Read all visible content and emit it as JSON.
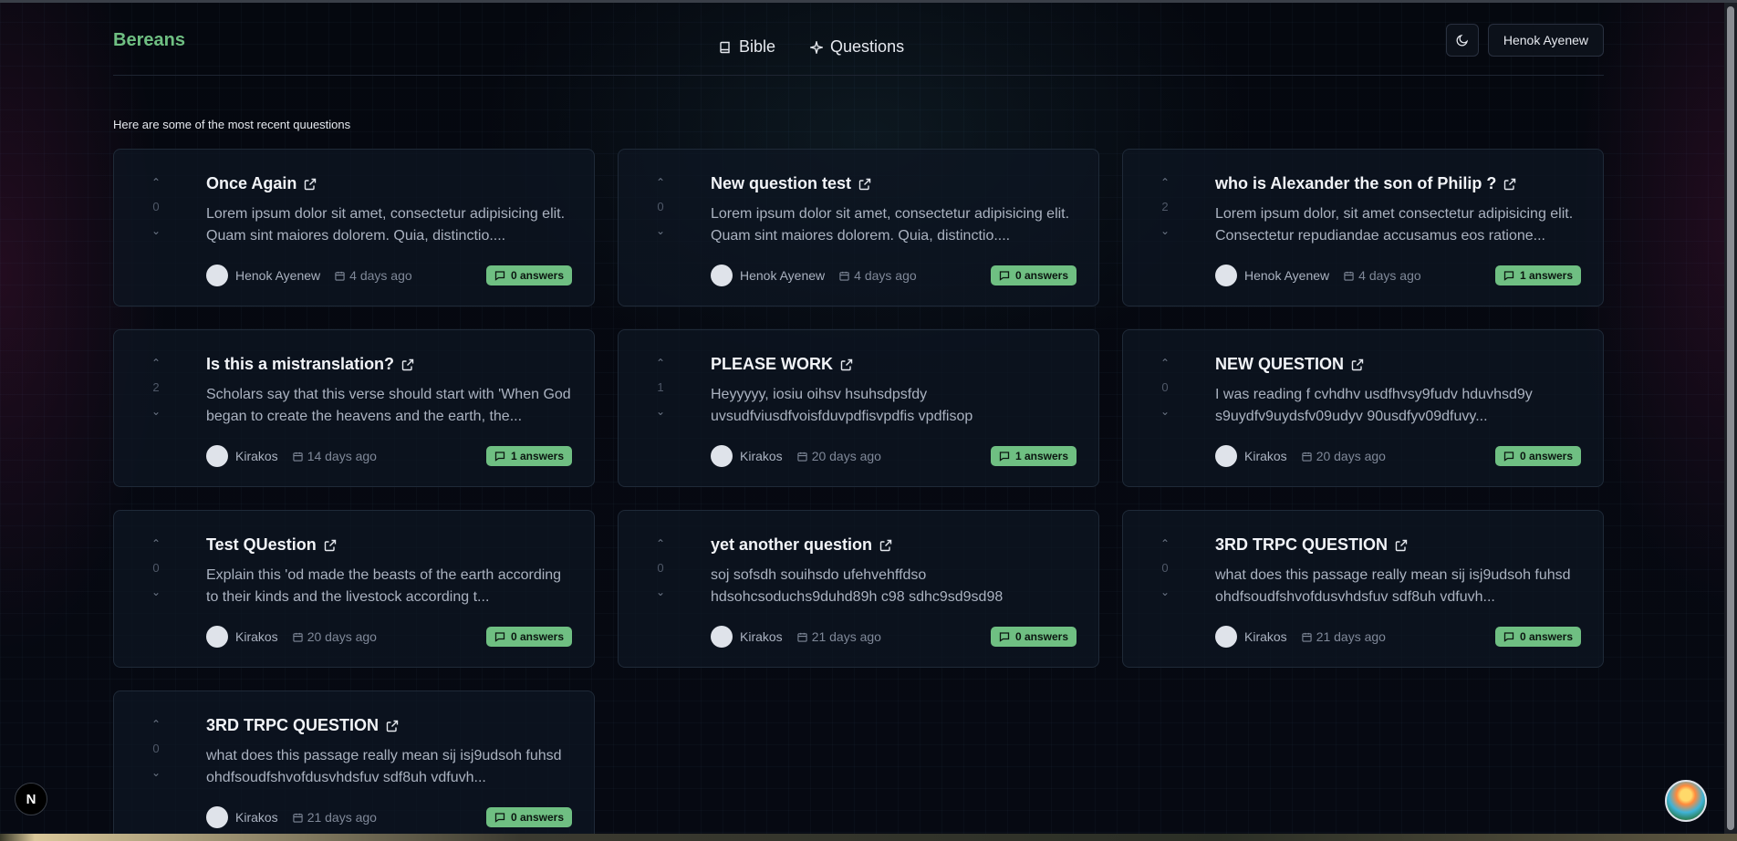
{
  "brand": "Bereans",
  "nav": [
    {
      "label": "Bible",
      "icon": "book-icon"
    },
    {
      "label": "Questions",
      "icon": "sparkle-icon"
    }
  ],
  "header": {
    "theme_toggle_icon": "moon-icon",
    "user_name": "Henok Ayenew"
  },
  "intro": "Here are some of the most recent quuestions",
  "colors": {
    "brand": "#6fbf82",
    "badge": "#6fbf82",
    "background": "#05080f"
  },
  "questions": [
    {
      "title": "Once Again",
      "votes": "0",
      "body": "Lorem ipsum dolor sit amet, consectetur adipisicing elit. Quam sint maiores dolorem. Quia, distinctio....",
      "author": "Henok Ayenew",
      "date": "4 days ago",
      "answers": "0 answers"
    },
    {
      "title": "New question test",
      "votes": "0",
      "body": "Lorem ipsum dolor sit amet, consectetur adipisicing elit. Quam sint maiores dolorem. Quia, distinctio....",
      "author": "Henok Ayenew",
      "date": "4 days ago",
      "answers": "0 answers"
    },
    {
      "title": "who is Alexander the son of Philip ?",
      "votes": "2",
      "body": "Lorem ipsum dolor, sit amet consectetur adipisicing elit. Consectetur repudiandae accusamus eos ratione...",
      "author": "Henok Ayenew",
      "date": "4 days ago",
      "answers": "1 answers"
    },
    {
      "title": "Is this a mistranslation?",
      "votes": "2",
      "body": "Scholars say that this verse should start with 'When God began to create the heavens and the earth, the...",
      "author": "Kirakos",
      "date": "14 days ago",
      "answers": "1 answers"
    },
    {
      "title": "PLEASE WORK",
      "votes": "1",
      "body": "Heyyyyy, iosiu oihsv hsuhsdpsfdy uvsudfviusdfvoisfduvpdfisvpdfis vpdfisop",
      "author": "Kirakos",
      "date": "20 days ago",
      "answers": "1 answers"
    },
    {
      "title": "NEW QUESTION",
      "votes": "0",
      "body": "I was reading f cvhdhv usdfhvsy9fudv hduvhsd9y s9uydfv9uydsfv09udyv 90usdfyv09dfuvy...",
      "author": "Kirakos",
      "date": "20 days ago",
      "answers": "0 answers"
    },
    {
      "title": "Test QUestion",
      "votes": "0",
      "body": "Explain this 'od made the beasts of the earth according to their kinds and the livestock according t...",
      "author": "Kirakos",
      "date": "20 days ago",
      "answers": "0 answers"
    },
    {
      "title": "yet another question",
      "votes": "0",
      "body": "soj sofsdh souihsdo ufehvehffdso hdsohcsoduchs9duhd89h c98 sdhc9sd9sd98",
      "author": "Kirakos",
      "date": "21 days ago",
      "answers": "0 answers"
    },
    {
      "title": "3RD TRPC QUESTION",
      "votes": "0",
      "body": "what does this passage really mean sij isj9udsoh fuhsd ohdfsoudfshvofdusvhdsfuv sdf8uh vdfuvh...",
      "author": "Kirakos",
      "date": "21 days ago",
      "answers": "0 answers"
    },
    {
      "title": "3RD TRPC QUESTION",
      "votes": "0",
      "body": "what does this passage really mean sij isj9udsoh fuhsd ohdfsoudfshvofdusvhdsfuv sdf8uh vdfuvh...",
      "author": "Kirakos",
      "date": "21 days ago",
      "answers": "0 answers"
    }
  ],
  "dev_indicator": "N"
}
